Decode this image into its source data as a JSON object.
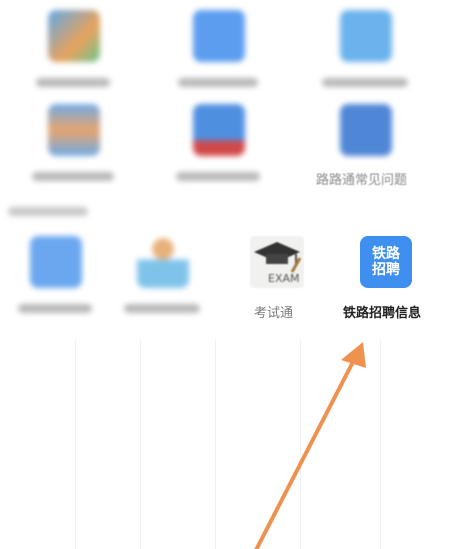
{
  "grid": {
    "faq_label": "路路通常见问题",
    "exam_label": "考试通",
    "exam_icon_text": "EXAM",
    "recruit_label": "铁路招聘信息",
    "recruit_icon_line1": "铁路",
    "recruit_icon_line2": "招聘"
  },
  "colors": {
    "accent_blue": "#3e8ff0",
    "arrow_orange": "#f0924f",
    "label_gray": "#8a8a8a"
  }
}
